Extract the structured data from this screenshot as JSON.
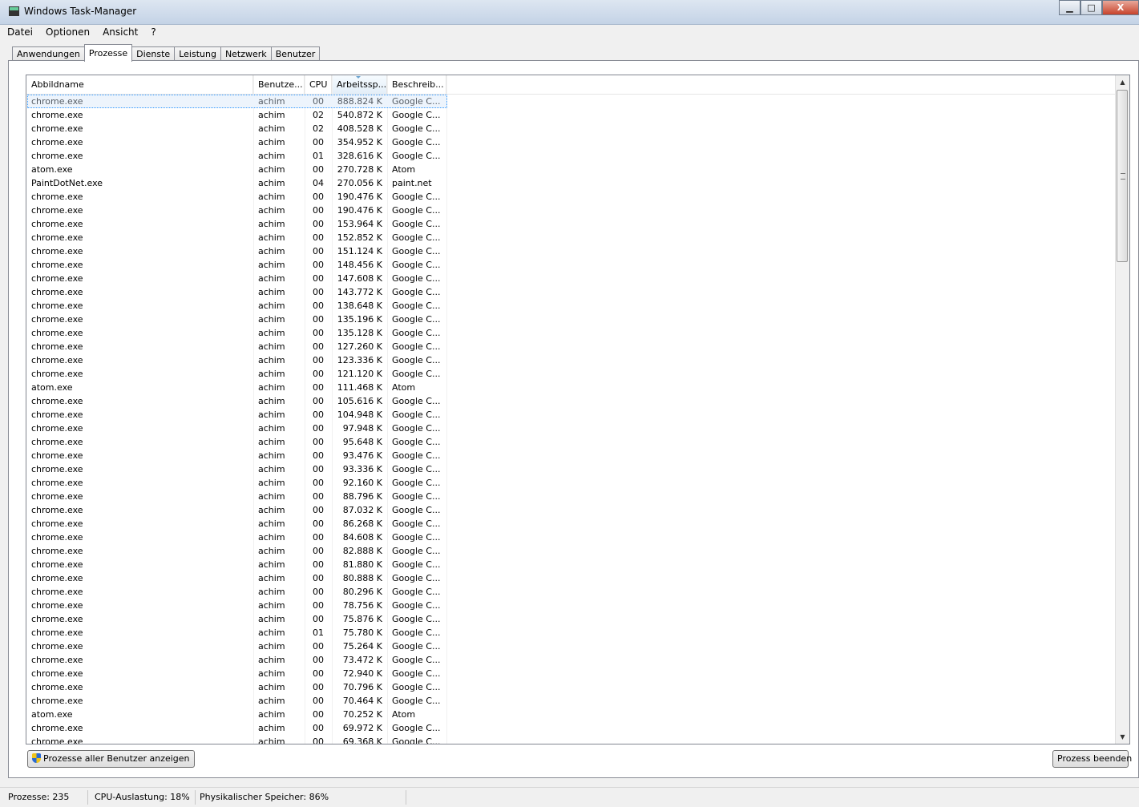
{
  "window": {
    "title": "Windows Task-Manager"
  },
  "menu": [
    "Datei",
    "Optionen",
    "Ansicht",
    "?"
  ],
  "tabs": [
    {
      "label": "Anwendungen",
      "active": false
    },
    {
      "label": "Prozesse",
      "active": true
    },
    {
      "label": "Dienste",
      "active": false
    },
    {
      "label": "Leistung",
      "active": false
    },
    {
      "label": "Netzwerk",
      "active": false
    },
    {
      "label": "Benutzer",
      "active": false
    }
  ],
  "columns": [
    "Abbildname",
    "Benutze...",
    "CPU",
    "Arbeitssp...",
    "Beschreib..."
  ],
  "sorted_column": 3,
  "selected_row": 0,
  "processes": [
    [
      "chrome.exe",
      "achim",
      "00",
      "888.824 K",
      "Google C..."
    ],
    [
      "chrome.exe",
      "achim",
      "02",
      "540.872 K",
      "Google C..."
    ],
    [
      "chrome.exe",
      "achim",
      "02",
      "408.528 K",
      "Google C..."
    ],
    [
      "chrome.exe",
      "achim",
      "00",
      "354.952 K",
      "Google C..."
    ],
    [
      "chrome.exe",
      "achim",
      "01",
      "328.616 K",
      "Google C..."
    ],
    [
      "atom.exe",
      "achim",
      "00",
      "270.728 K",
      "Atom"
    ],
    [
      "PaintDotNet.exe",
      "achim",
      "04",
      "270.056 K",
      "paint.net"
    ],
    [
      "chrome.exe",
      "achim",
      "00",
      "190.476 K",
      "Google C..."
    ],
    [
      "chrome.exe",
      "achim",
      "00",
      "190.476 K",
      "Google C..."
    ],
    [
      "chrome.exe",
      "achim",
      "00",
      "153.964 K",
      "Google C..."
    ],
    [
      "chrome.exe",
      "achim",
      "00",
      "152.852 K",
      "Google C..."
    ],
    [
      "chrome.exe",
      "achim",
      "00",
      "151.124 K",
      "Google C..."
    ],
    [
      "chrome.exe",
      "achim",
      "00",
      "148.456 K",
      "Google C..."
    ],
    [
      "chrome.exe",
      "achim",
      "00",
      "147.608 K",
      "Google C..."
    ],
    [
      "chrome.exe",
      "achim",
      "00",
      "143.772 K",
      "Google C..."
    ],
    [
      "chrome.exe",
      "achim",
      "00",
      "138.648 K",
      "Google C..."
    ],
    [
      "chrome.exe",
      "achim",
      "00",
      "135.196 K",
      "Google C..."
    ],
    [
      "chrome.exe",
      "achim",
      "00",
      "135.128 K",
      "Google C..."
    ],
    [
      "chrome.exe",
      "achim",
      "00",
      "127.260 K",
      "Google C..."
    ],
    [
      "chrome.exe",
      "achim",
      "00",
      "123.336 K",
      "Google C..."
    ],
    [
      "chrome.exe",
      "achim",
      "00",
      "121.120 K",
      "Google C..."
    ],
    [
      "atom.exe",
      "achim",
      "00",
      "111.468 K",
      "Atom"
    ],
    [
      "chrome.exe",
      "achim",
      "00",
      "105.616 K",
      "Google C..."
    ],
    [
      "chrome.exe",
      "achim",
      "00",
      "104.948 K",
      "Google C..."
    ],
    [
      "chrome.exe",
      "achim",
      "00",
      "97.948 K",
      "Google C..."
    ],
    [
      "chrome.exe",
      "achim",
      "00",
      "95.648 K",
      "Google C..."
    ],
    [
      "chrome.exe",
      "achim",
      "00",
      "93.476 K",
      "Google C..."
    ],
    [
      "chrome.exe",
      "achim",
      "00",
      "93.336 K",
      "Google C..."
    ],
    [
      "chrome.exe",
      "achim",
      "00",
      "92.160 K",
      "Google C..."
    ],
    [
      "chrome.exe",
      "achim",
      "00",
      "88.796 K",
      "Google C..."
    ],
    [
      "chrome.exe",
      "achim",
      "00",
      "87.032 K",
      "Google C..."
    ],
    [
      "chrome.exe",
      "achim",
      "00",
      "86.268 K",
      "Google C..."
    ],
    [
      "chrome.exe",
      "achim",
      "00",
      "84.608 K",
      "Google C..."
    ],
    [
      "chrome.exe",
      "achim",
      "00",
      "82.888 K",
      "Google C..."
    ],
    [
      "chrome.exe",
      "achim",
      "00",
      "81.880 K",
      "Google C..."
    ],
    [
      "chrome.exe",
      "achim",
      "00",
      "80.888 K",
      "Google C..."
    ],
    [
      "chrome.exe",
      "achim",
      "00",
      "80.296 K",
      "Google C..."
    ],
    [
      "chrome.exe",
      "achim",
      "00",
      "78.756 K",
      "Google C..."
    ],
    [
      "chrome.exe",
      "achim",
      "00",
      "75.876 K",
      "Google C..."
    ],
    [
      "chrome.exe",
      "achim",
      "01",
      "75.780 K",
      "Google C..."
    ],
    [
      "chrome.exe",
      "achim",
      "00",
      "75.264 K",
      "Google C..."
    ],
    [
      "chrome.exe",
      "achim",
      "00",
      "73.472 K",
      "Google C..."
    ],
    [
      "chrome.exe",
      "achim",
      "00",
      "72.940 K",
      "Google C..."
    ],
    [
      "chrome.exe",
      "achim",
      "00",
      "70.796 K",
      "Google C..."
    ],
    [
      "chrome.exe",
      "achim",
      "00",
      "70.464 K",
      "Google C..."
    ],
    [
      "atom.exe",
      "achim",
      "00",
      "70.252 K",
      "Atom"
    ],
    [
      "chrome.exe",
      "achim",
      "00",
      "69.972 K",
      "Google C..."
    ],
    [
      "chrome.exe",
      "achim",
      "00",
      "69.368 K",
      "Google C..."
    ]
  ],
  "buttons": {
    "show_all": "Prozesse aller Benutzer anzeigen",
    "end_process": "Prozess beenden"
  },
  "status": {
    "processes": "Prozesse: 235",
    "cpu": "CPU-Auslastung: 18%",
    "memory": "Physikalischer Speicher: 86%"
  },
  "window_buttons": {
    "minimize": "▁",
    "maximize": "□",
    "close": "X"
  }
}
